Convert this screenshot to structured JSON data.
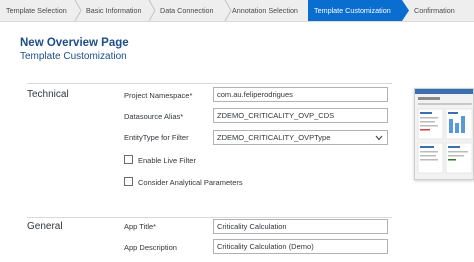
{
  "wizard": {
    "steps": [
      {
        "label": "Template Selection"
      },
      {
        "label": "Basic Information"
      },
      {
        "label": "Data Connection"
      },
      {
        "label": "Annotation Selection"
      },
      {
        "label": "Template Customization",
        "active": true
      },
      {
        "label": "Confirmation"
      }
    ]
  },
  "page": {
    "title": "New Overview Page",
    "subtitle": "Template Customization"
  },
  "technical": {
    "heading": "Technical",
    "project_namespace": {
      "label": "Project Namespace*",
      "value": "com.au.feliperodrigues"
    },
    "datasource_alias": {
      "label": "Datasource Alias*",
      "value": "ZDEMO_CRITICALITY_OVP_CDS"
    },
    "entity_type": {
      "label": "EntityType for Filter",
      "value": "ZDEMO_CRITICALITY_OVPType"
    },
    "live_filter": {
      "label": "Enable Live Filter",
      "checked": false
    },
    "analytical_params": {
      "label": "Consider Analytical Parameters",
      "checked": false
    }
  },
  "general": {
    "heading": "General",
    "app_title": {
      "label": "App Title*",
      "value": "Criticality Calculation"
    },
    "app_description": {
      "label": "App Description",
      "value": "Criticality Calculation (Demo)"
    }
  },
  "colors": {
    "active_step": "#0a6ed1",
    "title": "#1d4e8a",
    "step_bar": "#eeeeee"
  },
  "icons": {
    "step_separator": "chevron-right-icon",
    "dropdown": "chevron-down-icon"
  }
}
